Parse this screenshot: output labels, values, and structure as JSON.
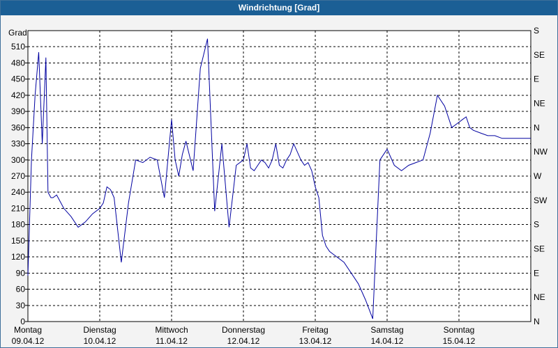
{
  "window": {
    "title": "Windrichtung [Grad]"
  },
  "chart_data": {
    "type": "line",
    "title": "Windrichtung [Grad]",
    "ylabel": "Grad",
    "ylim": [
      0,
      540
    ],
    "yticks": [
      0,
      30,
      60,
      90,
      120,
      150,
      180,
      210,
      240,
      270,
      300,
      330,
      360,
      390,
      420,
      450,
      480,
      510
    ],
    "right_ticks": [
      "N",
      "NE",
      "E",
      "SE",
      "S",
      "SW",
      "W",
      "NW",
      "N",
      "NE",
      "E",
      "SE",
      "S"
    ],
    "xlim": [
      0,
      7
    ],
    "xticks": [
      {
        "day": "Montag",
        "date": "09.04.12"
      },
      {
        "day": "Dienstag",
        "date": "10.04.12"
      },
      {
        "day": "Mittwoch",
        "date": "11.04.12"
      },
      {
        "day": "Donnerstag",
        "date": "12.04.12"
      },
      {
        "day": "Freitag",
        "date": "13.04.12"
      },
      {
        "day": "Samstag",
        "date": "14.04.12"
      },
      {
        "day": "Sonntag",
        "date": "15.04.12"
      }
    ],
    "grid": true,
    "line_color": "#0000a0",
    "series": [
      {
        "x": [
          0.0,
          0.05,
          0.1,
          0.15,
          0.2,
          0.25,
          0.28,
          0.32,
          0.35,
          0.4,
          0.5,
          0.6,
          0.7,
          0.8,
          0.9,
          1.0,
          1.05,
          1.1,
          1.15,
          1.2,
          1.3,
          1.4,
          1.5,
          1.6,
          1.7,
          1.8,
          1.9,
          2.0,
          2.05,
          2.1,
          2.15,
          2.2,
          2.3,
          2.4,
          2.5,
          2.6,
          2.7,
          2.8,
          2.9,
          3.0,
          3.05,
          3.1,
          3.15,
          3.2,
          3.25,
          3.3,
          3.35,
          3.4,
          3.45,
          3.5,
          3.55,
          3.6,
          3.65,
          3.7,
          3.8,
          3.85,
          3.9,
          3.95,
          4.0,
          4.05,
          4.1,
          4.15,
          4.2,
          4.3,
          4.4,
          4.5,
          4.6,
          4.7,
          4.8,
          4.9,
          5.0,
          5.1,
          5.2,
          5.3,
          5.4,
          5.5,
          5.6,
          5.7,
          5.8,
          5.9,
          6.0,
          6.05,
          6.1,
          6.15,
          6.2,
          6.3,
          6.4,
          6.5,
          6.6,
          6.7,
          6.8,
          6.9,
          7.0
        ],
        "y": [
          85,
          300,
          420,
          500,
          330,
          490,
          240,
          230,
          230,
          235,
          210,
          195,
          175,
          185,
          200,
          210,
          220,
          250,
          245,
          230,
          110,
          220,
          300,
          295,
          305,
          300,
          230,
          375,
          300,
          270,
          310,
          335,
          280,
          470,
          525,
          205,
          330,
          175,
          290,
          300,
          330,
          285,
          280,
          290,
          300,
          295,
          285,
          300,
          330,
          290,
          285,
          300,
          310,
          330,
          300,
          290,
          295,
          280,
          250,
          230,
          160,
          140,
          130,
          120,
          110,
          90,
          70,
          40,
          5,
          300,
          320,
          290,
          280,
          290,
          295,
          300,
          350,
          420,
          400,
          360,
          370,
          375,
          380,
          360,
          355,
          350,
          345,
          345,
          340,
          340,
          340,
          340,
          340
        ]
      }
    ]
  }
}
